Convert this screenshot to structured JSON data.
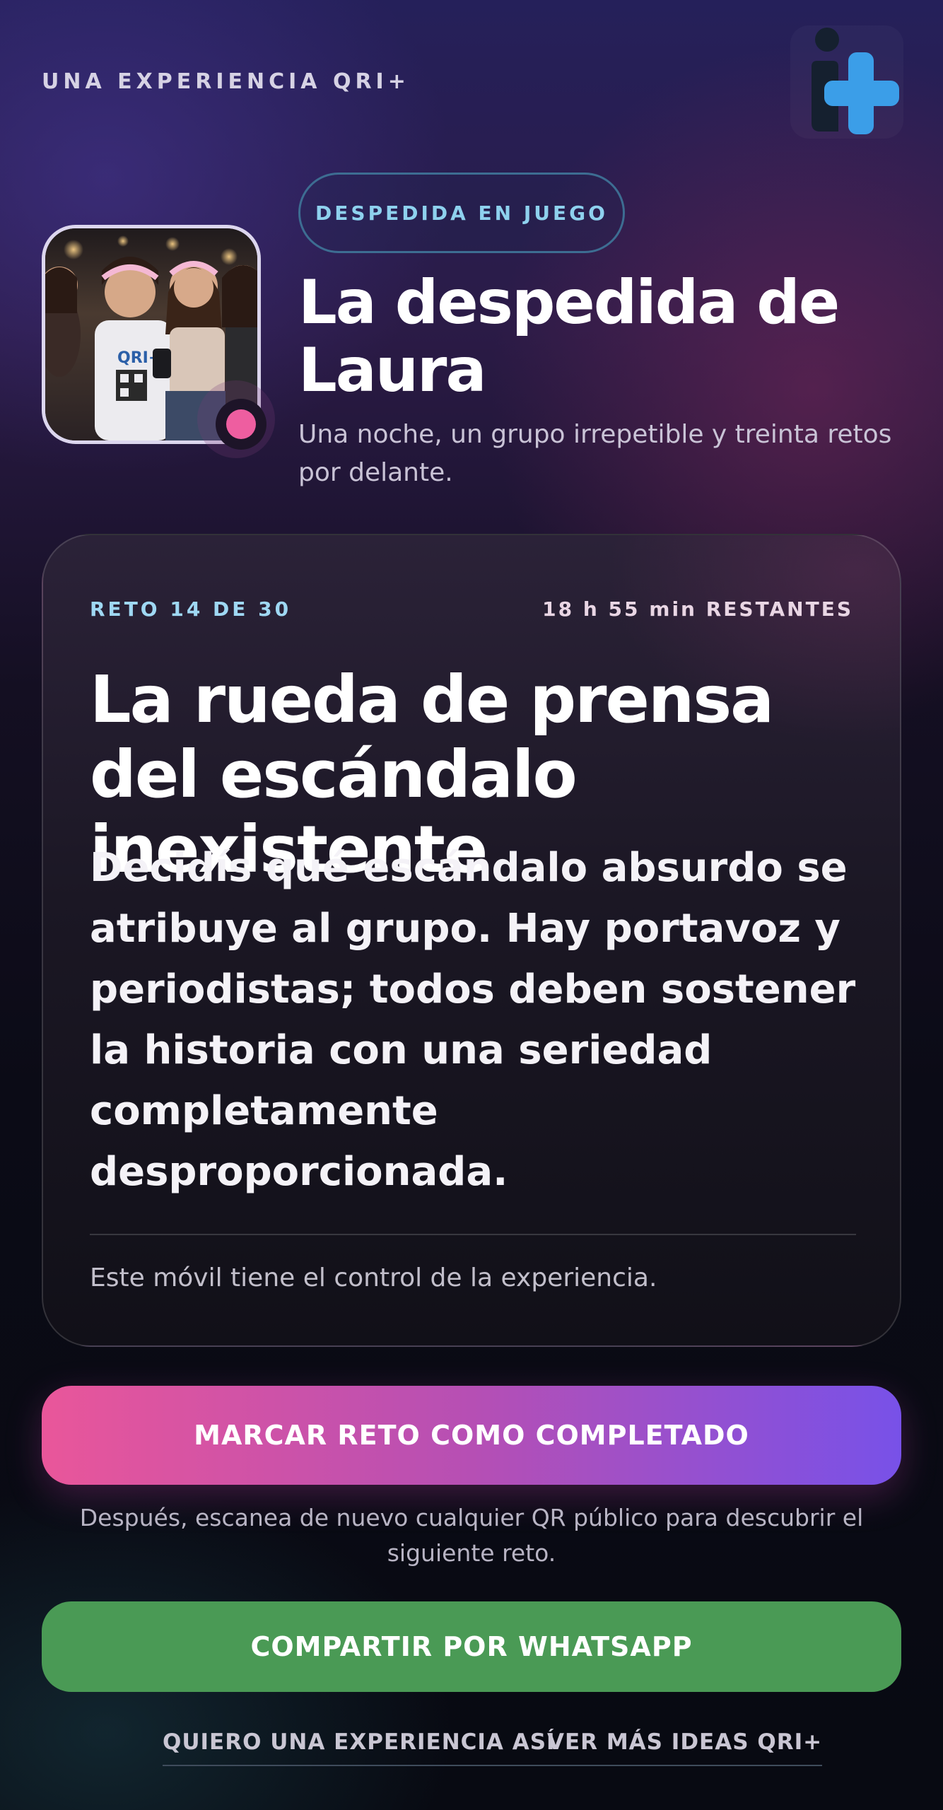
{
  "header": {
    "brand": "UNA EXPERIENCIA QRI+",
    "logo_icon": "qri-plus-logo-icon"
  },
  "event": {
    "badge": "DESPEDIDA EN JUEGO",
    "title": "La despedida de Laura",
    "subtitle": "Una noche, un grupo irrepetible y treinta retos por delante.",
    "photo_shirt_text": "QRI+"
  },
  "challenge": {
    "progress_label": "RETO 14 DE 30",
    "time_remaining": "18 h 55 min RESTANTES",
    "title": "La rueda de prensa del escándalo inexistente",
    "description": "Decidís qué escándalo absurdo se atribuye al grupo. Hay portavoz y periodistas; todos deben sostener la historia con una seriedad completamente desproporcionada.",
    "control_note": "Este móvil tiene el control de la experiencia."
  },
  "actions": {
    "complete_label": "MARCAR RETO COMO COMPLETADO",
    "hint": "Después, escanea de nuevo cualquier QR público para descubrir el siguiente reto.",
    "whatsapp_label": "COMPARTIR POR WHATSAPP"
  },
  "links": {
    "want_experience": "QUIERO UNA EXPERIENCIA ASÍ",
    "more_ideas": "VER MÁS IDEAS QRI+"
  },
  "colors": {
    "accent_cyan": "#8ed1ee",
    "accent_pink": "#ee5ea0",
    "accent_violet": "#7851e8",
    "whatsapp_green": "#4a9a55"
  }
}
